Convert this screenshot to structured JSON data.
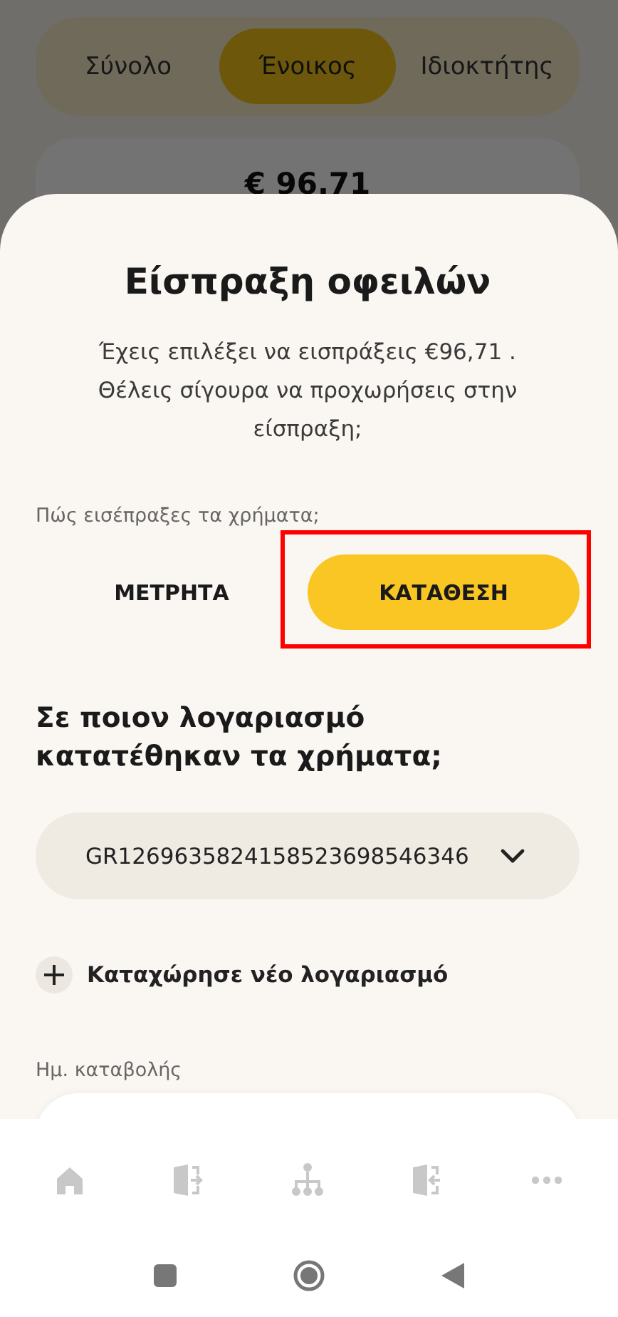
{
  "background": {
    "tabs": [
      {
        "label": "Σύνολο",
        "selected": false
      },
      {
        "label": "Ένοικος",
        "selected": true
      },
      {
        "label": "Ιδιοκτήτης",
        "selected": false
      }
    ],
    "amount": "€ 96.71"
  },
  "dialog": {
    "title": "Είσπραξη οφειλών",
    "message": "Έχεις επιλέξει να εισπράξεις €96,71 . Θέλεις σίγουρα να προχωρήσεις στην είσπραξη;",
    "method_label": "Πώς εισέπραξες τα χρήματα;",
    "methods": [
      {
        "label": "ΜΕΤΡΗΤΑ",
        "selected": false,
        "highlighted": false
      },
      {
        "label": "ΚΑΤΑΘΕΣΗ",
        "selected": true,
        "highlighted": true
      }
    ],
    "account_heading": "Σε ποιον λογαριασμό κατατέθηκαν τα χρήματα;",
    "account": {
      "value": "GR1269635824158523698546346"
    },
    "add_account": "Καταχώρησε νέο λογαριασμό",
    "date_label": "Ημ. καταβολής"
  }
}
